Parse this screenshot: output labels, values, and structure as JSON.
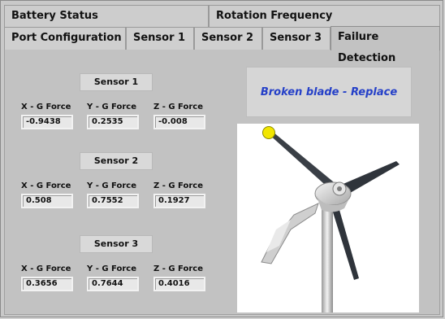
{
  "tabs_row1": [
    {
      "label": "Battery Status"
    },
    {
      "label": "Rotation Frequency"
    }
  ],
  "tabs_row2": [
    {
      "label": "Port Configuration"
    },
    {
      "label": "Sensor 1"
    },
    {
      "label": "Sensor 2"
    },
    {
      "label": "Sensor 3"
    },
    {
      "label": "Failure Detection"
    }
  ],
  "sensors": [
    {
      "title": "Sensor 1",
      "x_label": "X - G Force",
      "y_label": "Y - G Force",
      "z_label": "Z - G Force",
      "x": "-0.9438",
      "y": "0.2535",
      "z": "-0.008"
    },
    {
      "title": "Sensor 2",
      "x_label": "X - G Force",
      "y_label": "Y - G Force",
      "z_label": "Z - G Force",
      "x": "0.508",
      "y": "0.7552",
      "z": "0.1927"
    },
    {
      "title": "Sensor 3",
      "x_label": "X - G Force",
      "y_label": "Y - G Force",
      "z_label": "Z - G Force",
      "x": "0.3656",
      "y": "0.7644",
      "z": "0.4016"
    }
  ],
  "status": {
    "text": "Broken blade - Replace",
    "color": "#2540c8"
  },
  "indicator": {
    "color": "#f2e600"
  },
  "image": {
    "icon": "wind-turbine-icon"
  }
}
